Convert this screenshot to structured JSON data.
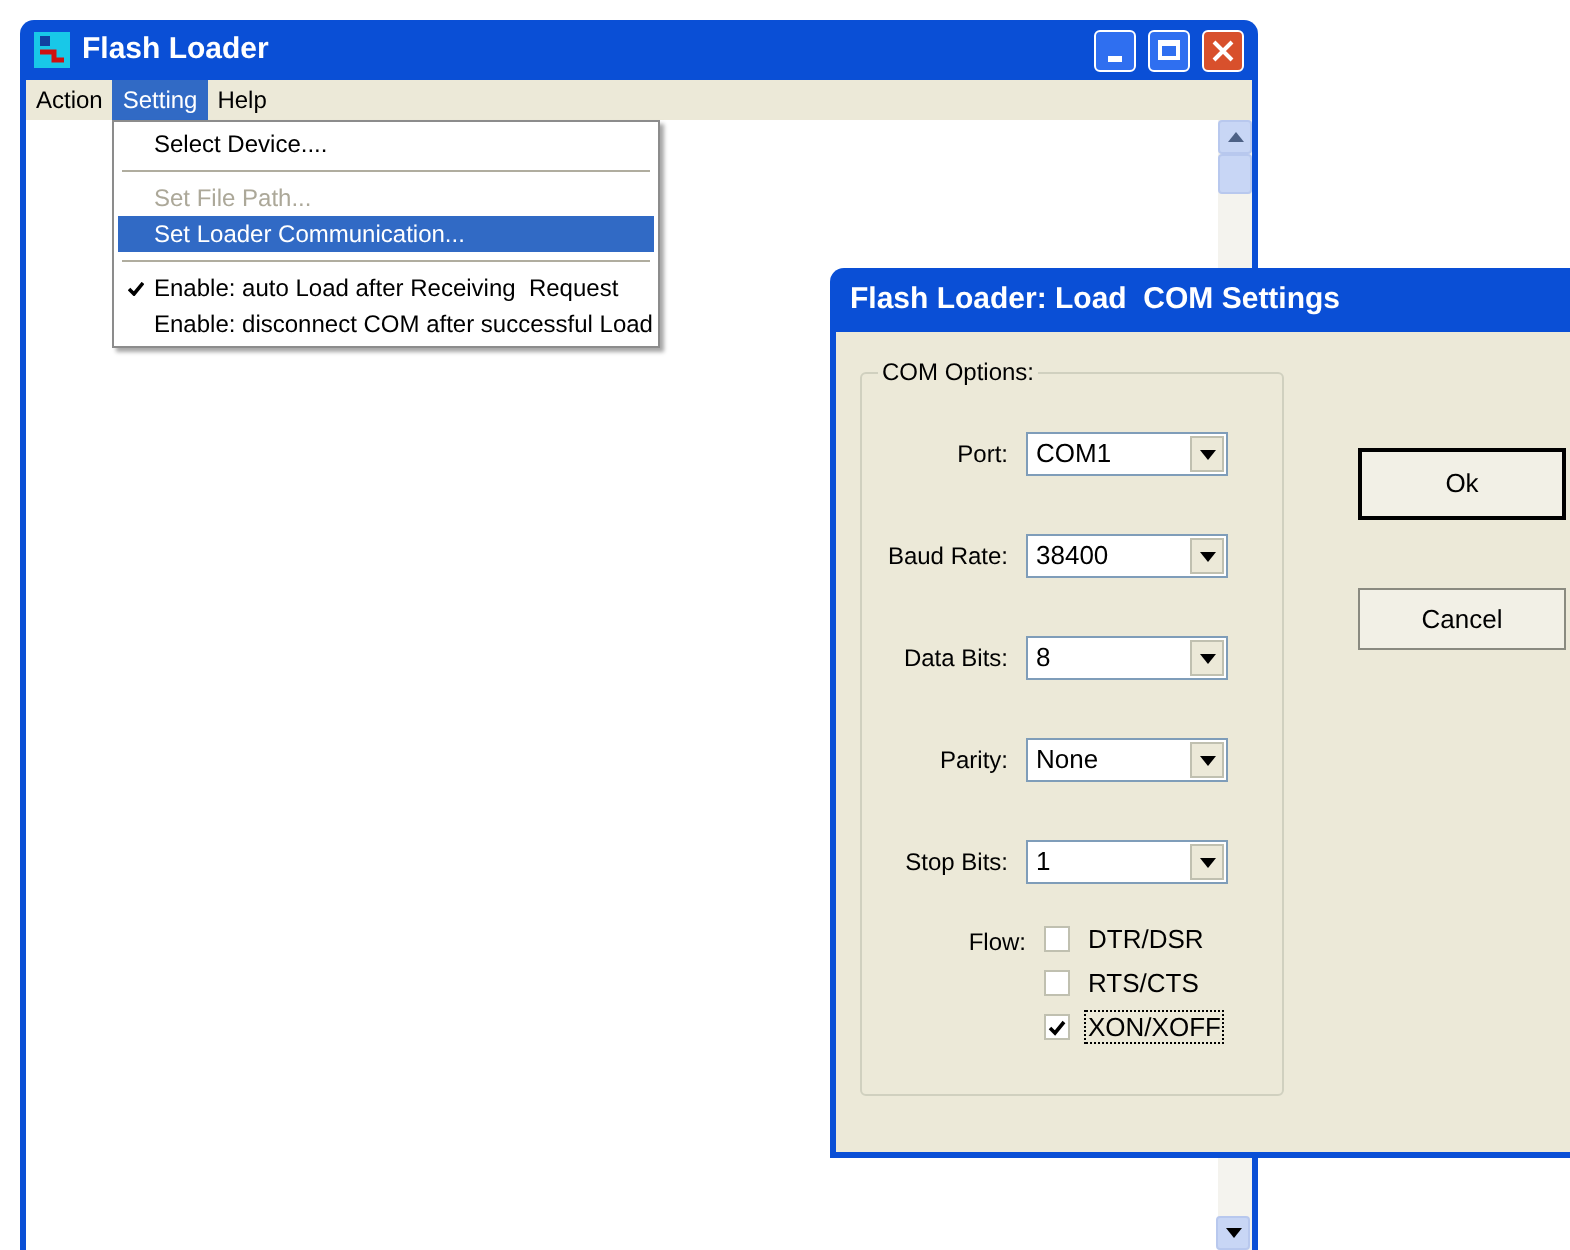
{
  "main_window": {
    "title": "Flash Loader",
    "menu": [
      {
        "label": "Action",
        "selected": false
      },
      {
        "label": "Setting",
        "selected": true
      },
      {
        "label": "Help",
        "selected": false
      }
    ]
  },
  "dropdown": {
    "items": [
      {
        "kind": "item",
        "label": "Select Device....",
        "disabled": false,
        "selected": false
      },
      {
        "kind": "separator"
      },
      {
        "kind": "item",
        "label": "Set File Path...",
        "disabled": true,
        "selected": false
      },
      {
        "kind": "item",
        "label": "Set Loader Communication...",
        "disabled": false,
        "selected": true
      },
      {
        "kind": "separator"
      },
      {
        "kind": "check",
        "label": "Enable: auto Load after Receiving  Request",
        "checked": true
      },
      {
        "kind": "check",
        "label": "Enable: disconnect COM after successful Load",
        "checked": false
      }
    ]
  },
  "dialog": {
    "title": "Flash Loader: Load  COM Settings",
    "group": "COM Options:",
    "fields": [
      {
        "label": "Port:",
        "value": "COM1"
      },
      {
        "label": "Baud Rate:",
        "value": "38400"
      },
      {
        "label": "Data Bits:",
        "value": "8"
      },
      {
        "label": "Parity:",
        "value": "None"
      },
      {
        "label": "Stop Bits:",
        "value": "1"
      }
    ],
    "flow": {
      "label": "Flow:",
      "options": [
        {
          "label": "DTR/DSR",
          "checked": false,
          "focused": false
        },
        {
          "label": "RTS/CTS",
          "checked": false,
          "focused": false
        },
        {
          "label": "XON/XOFF",
          "checked": true,
          "focused": true
        }
      ]
    },
    "buttons": [
      {
        "label": "Ok",
        "default": true
      },
      {
        "label": "Cancel",
        "default": false
      }
    ]
  }
}
